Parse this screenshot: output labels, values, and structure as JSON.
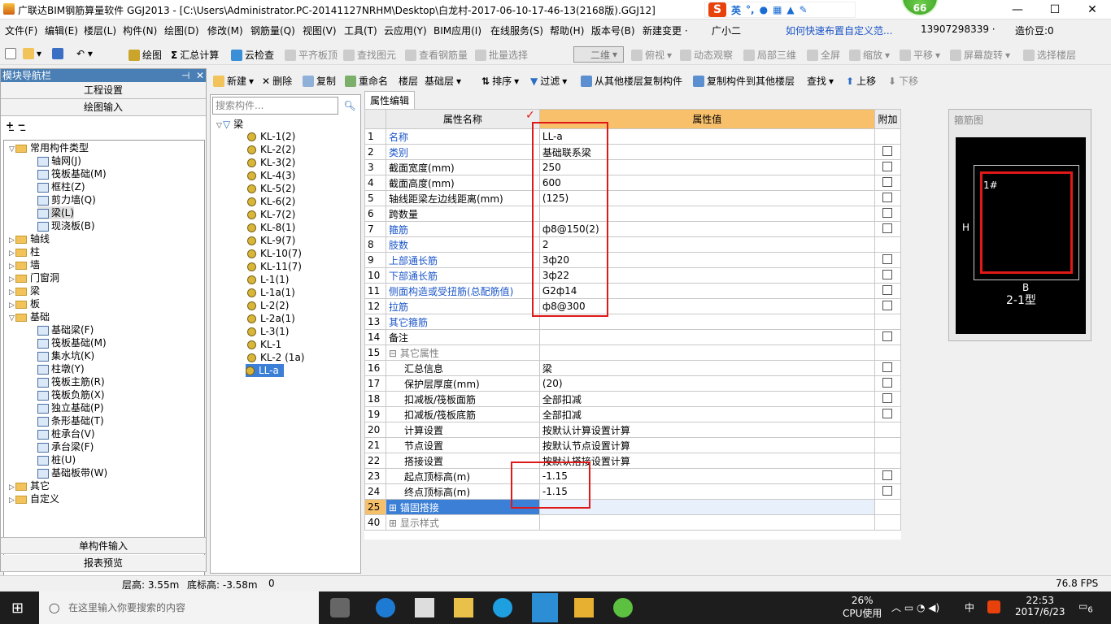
{
  "window": {
    "title": "广联达BIM钢筋算量软件 GGJ2013 - [C:\\Users\\Administrator.PC-20141127NRHM\\Desktop\\白龙村-2017-06-10-17-46-13(2168版).GGJ12]",
    "badge": "66",
    "min": "—",
    "max": "☐",
    "close": "✕"
  },
  "ime": {
    "lang": "英"
  },
  "menu": [
    "文件(F)",
    "编辑(E)",
    "楼层(L)",
    "构件(N)",
    "绘图(D)",
    "修改(M)",
    "钢筋量(Q)",
    "视图(V)",
    "工具(T)",
    "云应用(Y)",
    "BIM应用(I)",
    "在线服务(S)",
    "帮助(H)",
    "版本号(B)",
    "新建变更 ·",
    "广小二",
    "如何快速布置自定义范...",
    "13907298339 ·",
    "造价豆:0"
  ],
  "toolbar1": {
    "draw": "绘图",
    "sum": "汇总计算",
    "cloud": "云检查",
    "flat": "平齐板顶",
    "find": "查找图元",
    "viewrebar": "查看钢筋量",
    "batch": "批量选择",
    "mode": "二维",
    "view": "俯视",
    "dyn": "动态观察",
    "local3d": "局部三维",
    "fullscreen": "全屏",
    "zoom": "缩放",
    "pan": "平移",
    "rotate": "屏幕旋转",
    "selfloor": "选择楼层"
  },
  "nav": {
    "title": "模块导航栏",
    "pin": "⊣",
    "close": "✕",
    "project": "工程设置",
    "drawing": "绘图输入",
    "single": "单构件输入",
    "report": "报表预览"
  },
  "tree": {
    "common": "常用构件类型",
    "common_items": [
      "轴网(J)",
      "筏板基础(M)",
      "框柱(Z)",
      "剪力墙(Q)",
      "梁(L)",
      "现浇板(B)"
    ],
    "axis": "轴线",
    "col": "柱",
    "wall": "墙",
    "door": "门窗洞",
    "beam": "梁",
    "slab": "板",
    "found": "基础",
    "found_items": [
      "基础梁(F)",
      "筏板基础(M)",
      "集水坑(K)",
      "柱墩(Y)",
      "筏板主筋(R)",
      "筏板负筋(X)",
      "独立基础(P)",
      "条形基础(T)",
      "桩承台(V)",
      "承台梁(F)",
      "桩(U)",
      "基础板带(W)"
    ],
    "other": "其它",
    "custom": "自定义"
  },
  "toolbar2": {
    "new": "新建",
    "del": "删除",
    "copy": "复制",
    "rename": "重命名",
    "floor": "楼层",
    "floorval": "基础层",
    "sort": "排序",
    "filter": "过滤",
    "copyfrom": "从其他楼层复制构件",
    "copyto": "复制构件到其他楼层",
    "find": "查找",
    "up": "上移",
    "down": "下移"
  },
  "components": {
    "search_placeholder": "搜索构件...",
    "root": "梁",
    "items": [
      "KL-1(2)",
      "KL-2(2)",
      "KL-3(2)",
      "KL-4(3)",
      "KL-5(2)",
      "KL-6(2)",
      "KL-7(2)",
      "KL-8(1)",
      "KL-9(7)",
      "KL-10(7)",
      "KL-11(7)",
      "L-1(1)",
      "L-1a(1)",
      "L-2(2)",
      "L-2a(1)",
      "L-3(1)",
      "KL-1",
      "KL-2 (1a)",
      "LL-a"
    ]
  },
  "props": {
    "tab": "属性编辑",
    "h_name": "属性名称",
    "h_value": "属性值",
    "h_add": "附加",
    "rows": [
      [
        "1",
        "名称",
        "LL-a"
      ],
      [
        "2",
        "类别",
        "基础联系梁"
      ],
      [
        "3",
        "截面宽度(mm)",
        "250"
      ],
      [
        "4",
        "截面高度(mm)",
        "600"
      ],
      [
        "5",
        "轴线距梁左边线距离(mm)",
        "(125)"
      ],
      [
        "6",
        "跨数量",
        ""
      ],
      [
        "7",
        "箍筋",
        "ф8@150(2)"
      ],
      [
        "8",
        "肢数",
        "2"
      ],
      [
        "9",
        "上部通长筋",
        "3ф20"
      ],
      [
        "10",
        "下部通长筋",
        "3ф22"
      ],
      [
        "11",
        "侧面构造或受扭筋(总配筋值)",
        "G2ф14"
      ],
      [
        "12",
        "拉筋",
        "ф8@300"
      ],
      [
        "13",
        "其它箍筋",
        ""
      ],
      [
        "14",
        "备注",
        ""
      ],
      [
        "15",
        "其它属性",
        ""
      ],
      [
        "16",
        "汇总信息",
        "梁"
      ],
      [
        "17",
        "保护层厚度(mm)",
        "(20)"
      ],
      [
        "18",
        "扣减板/筏板面筋",
        "全部扣减"
      ],
      [
        "19",
        "扣减板/筏板底筋",
        "全部扣减"
      ],
      [
        "20",
        "计算设置",
        "按默认计算设置计算"
      ],
      [
        "21",
        "节点设置",
        "按默认节点设置计算"
      ],
      [
        "22",
        "搭接设置",
        "按默认搭接设置计算"
      ],
      [
        "23",
        "起点顶标高(m)",
        "-1.15"
      ],
      [
        "24",
        "终点顶标高(m)",
        "-1.15"
      ],
      [
        "25",
        "锚固搭接",
        ""
      ],
      [
        "40",
        "显示样式",
        ""
      ]
    ]
  },
  "rebar": {
    "title": "箍筋图",
    "label1": "1#",
    "labelH": "H",
    "labelB": "B",
    "type": "2-1型"
  },
  "status": {
    "floorh": "层高: 3.55m",
    "bottom": "底标高: -3.58m",
    "zero": "0",
    "fps": "76.8 FPS"
  },
  "taskbar": {
    "search": "在这里输入你要搜索的内容",
    "cpu": "26%",
    "cpulabel": "CPU使用",
    "time": "22:53",
    "date": "2017/6/23",
    "lang": "中",
    "notif": "6"
  }
}
